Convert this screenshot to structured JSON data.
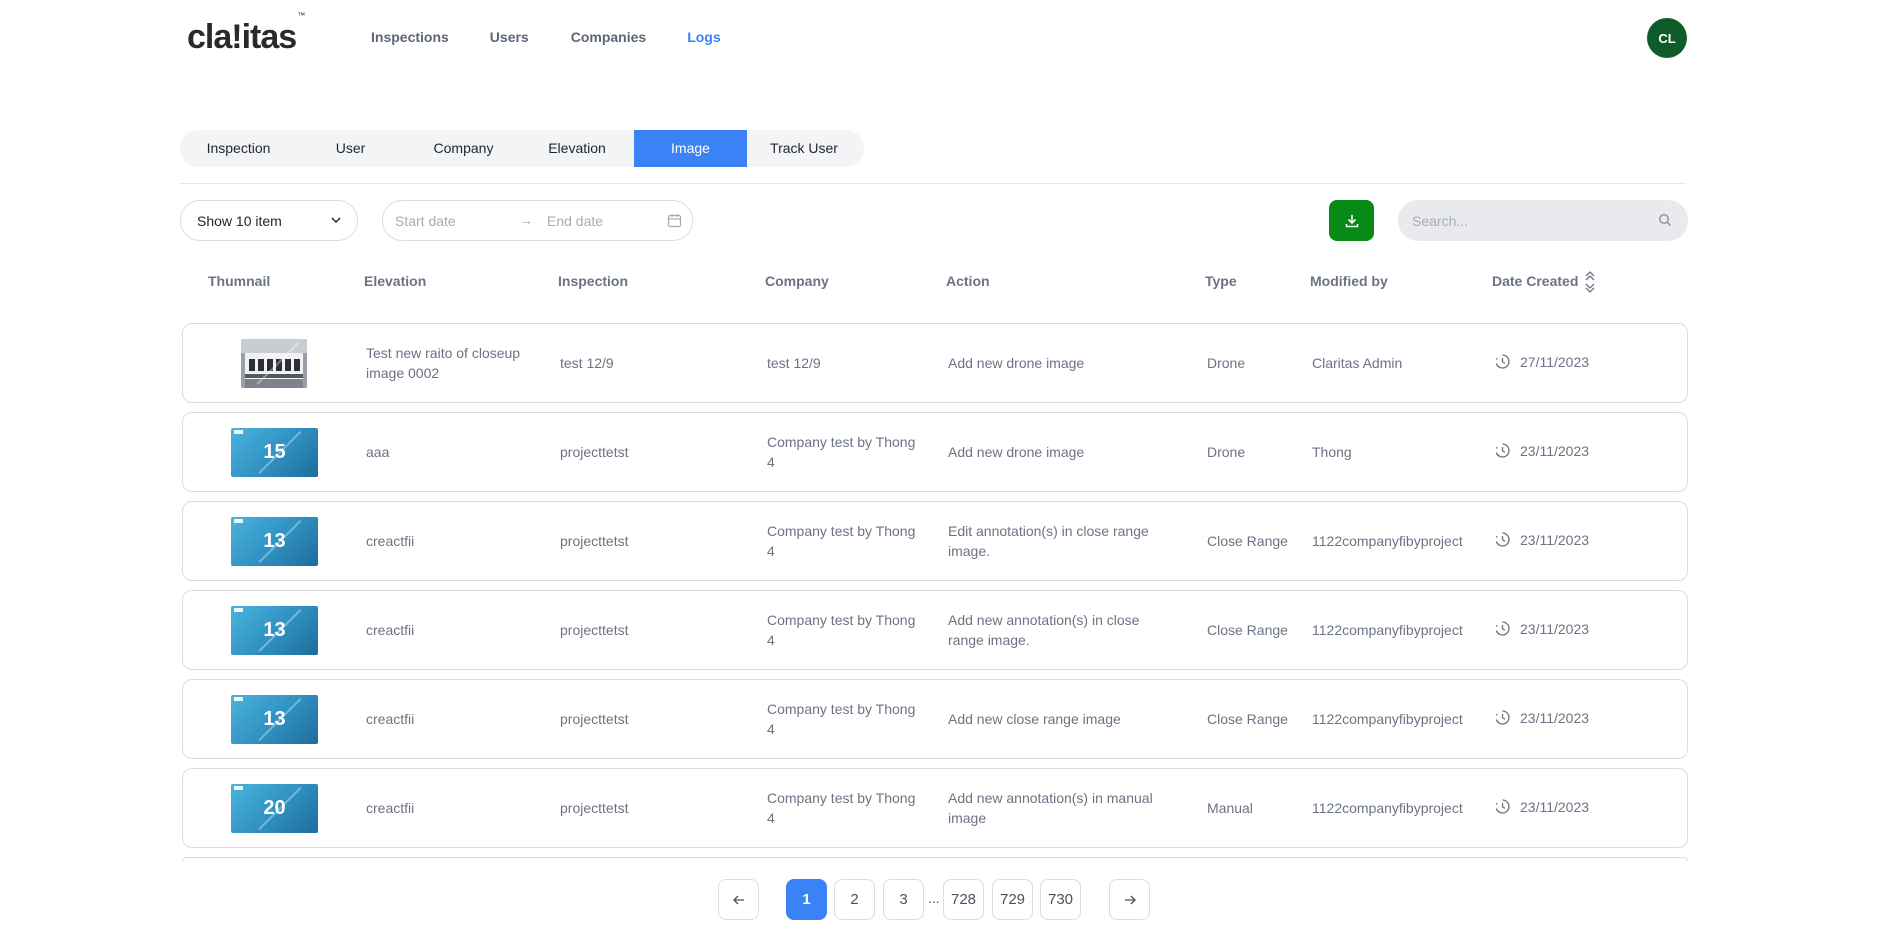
{
  "brand": {
    "logo_text": "cla!itas",
    "tm": "™"
  },
  "nav": [
    {
      "label": "Inspections"
    },
    {
      "label": "Users"
    },
    {
      "label": "Companies"
    },
    {
      "label": "Logs",
      "active": true
    }
  ],
  "user": {
    "initials": "CL"
  },
  "tabs": [
    {
      "label": "Inspection"
    },
    {
      "label": "User"
    },
    {
      "label": "Company"
    },
    {
      "label": "Elevation"
    },
    {
      "label": "Image",
      "active": true
    },
    {
      "label": "Track User"
    }
  ],
  "filters": {
    "show_items": "Show 10 item",
    "start_placeholder": "Start date",
    "end_placeholder": "End date",
    "search_placeholder": "Search..."
  },
  "columns": [
    "Thumnail",
    "Elevation",
    "Inspection",
    "Company",
    "Action",
    "Type",
    "Modified by",
    "Date Created"
  ],
  "rows": [
    {
      "thumb": "photo",
      "thumb_label": "",
      "elevation": [
        "Test new raito of closeup",
        "image 0002"
      ],
      "inspection": "test 12/9",
      "company": [
        "test 12/9"
      ],
      "action": [
        "Add new drone image"
      ],
      "type": "Drone",
      "modified_by": "Claritas Admin",
      "date": "27/11/2023"
    },
    {
      "thumb": "tile",
      "thumb_label": "15",
      "elevation": [
        "aaa"
      ],
      "inspection": "projecttetst",
      "company": [
        "Company test by Thong",
        "4"
      ],
      "action": [
        "Add new drone image"
      ],
      "type": "Drone",
      "modified_by": "Thong",
      "date": "23/11/2023"
    },
    {
      "thumb": "tile",
      "thumb_label": "13",
      "elevation": [
        "creactfii"
      ],
      "inspection": "projecttetst",
      "company": [
        "Company test by Thong",
        "4"
      ],
      "action": [
        "Edit annotation(s) in close range",
        "image."
      ],
      "type": "Close Range",
      "modified_by": "1122companyfibyproject",
      "date": "23/11/2023"
    },
    {
      "thumb": "tile",
      "thumb_label": "13",
      "elevation": [
        "creactfii"
      ],
      "inspection": "projecttetst",
      "company": [
        "Company test by Thong",
        "4"
      ],
      "action": [
        "Add new annotation(s) in close",
        "range image."
      ],
      "type": "Close Range",
      "modified_by": "1122companyfibyproject",
      "date": "23/11/2023"
    },
    {
      "thumb": "tile",
      "thumb_label": "13",
      "elevation": [
        "creactfii"
      ],
      "inspection": "projecttetst",
      "company": [
        "Company test by Thong",
        "4"
      ],
      "action": [
        "Add new close range image"
      ],
      "type": "Close Range",
      "modified_by": "1122companyfibyproject",
      "date": "23/11/2023"
    },
    {
      "thumb": "tile",
      "thumb_label": "20",
      "elevation": [
        "creactfii"
      ],
      "inspection": "projecttetst",
      "company": [
        "Company test by Thong",
        "4"
      ],
      "action": [
        "Add new annotation(s) in manual",
        "image"
      ],
      "type": "Manual",
      "modified_by": "1122companyfibyproject",
      "date": "23/11/2023"
    }
  ],
  "pagination": {
    "pages": [
      "1",
      "2",
      "3",
      "728",
      "729",
      "730"
    ],
    "current": "1",
    "ellipsis": "..."
  },
  "colors": {
    "accent": "#3b82f6",
    "download": "#078b16",
    "avatar": "#0f5b2a"
  }
}
